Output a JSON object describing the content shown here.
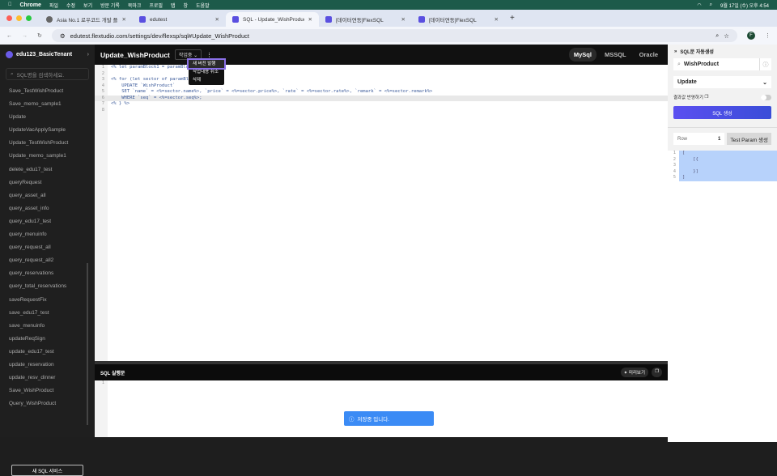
{
  "menubar": {
    "app": "Chrome",
    "items": [
      "파일",
      "수정",
      "보기",
      "방문 기록",
      "북마크",
      "프로필",
      "탭",
      "창",
      "도움말"
    ],
    "clock": "9월 17일 (수) 오후 4:54"
  },
  "browser": {
    "tabs": [
      {
        "title": "Asia No.1 로우코드 개발 플랫폼 |"
      },
      {
        "title": "edutest"
      },
      {
        "title": "SQL - Update_WishProduct",
        "active": true
      },
      {
        "title": "[데이터연동]FlexSQL"
      },
      {
        "title": "[데이터연동]FlexSQL"
      }
    ],
    "url": "edutest.flextudio.com/settings/dev/flexsp/sql#Update_WishProduct",
    "profile": "F"
  },
  "sidebar": {
    "tenant": "edu123_BasicTenant",
    "search_placeholder": "SQL명을 검색하세요.",
    "items": [
      "Save_TestWishProduct",
      "Save_memo_sample1",
      "Update",
      "UpdateVacApplySample",
      "Update_TestWishProduct",
      "Update_memo_sample1",
      "delete_edu17_test",
      "queryRequest",
      "query_asset_all",
      "query_asset_info",
      "query_edu17_test",
      "query_menuinfo",
      "query_request_all",
      "query_request_all2",
      "query_reservations",
      "query_total_reservations",
      "saveRequestFix",
      "save_edu17_test",
      "save_menuinfo",
      "updateReqSign",
      "update_edu17_test",
      "update_reservation",
      "update_resv_dinner",
      "Save_WishProduct",
      "Query_WishProduct"
    ],
    "new_button": "새 SQL 서비스"
  },
  "editor": {
    "title": "Update_WishProduct",
    "status": "작업중",
    "db_tabs": [
      "MySql",
      "MSSQL",
      "Oracle"
    ],
    "active_db": "MySql",
    "lines": [
      "<% let paramBlock1 = paramBlo",
      "",
      "<% for (let sector of paramBlo",
      "    UPDATE `WishProduct`",
      "    SET `name` = <%=sector.name%>, `price` = <%=sector.price%>, `rate` = <%=sector.rate%>, `remark` = <%=sector.remark%>",
      "    WHERE `seq` = <%=sector.seq%>;",
      "<% } %>",
      ""
    ],
    "menu": [
      "새 버전 발행",
      "작업내용 취소",
      "삭제"
    ]
  },
  "bottom": {
    "title": "SQL 실행문",
    "preview": "미리보기",
    "lines": [
      ""
    ]
  },
  "toast": {
    "message": "저장중 입니다."
  },
  "right_panel": {
    "title": "SQL문 자동생성",
    "search_value": "WishProduct",
    "select_value": "Update",
    "toggle_label": "결과값 반영하기",
    "toggle_on": false,
    "generate_button": "SQL 생성",
    "row_label": "Row",
    "row_value": "1",
    "test_param_button": "Test Param 생성",
    "json_lines": [
      "[",
      "    [{",
      "",
      "    }]",
      "]"
    ]
  }
}
